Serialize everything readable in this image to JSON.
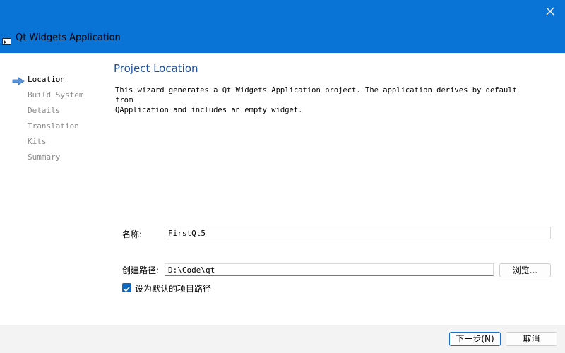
{
  "window": {
    "title": "Qt Widgets Application",
    "titlebar_color": "#0a74d6"
  },
  "sidebar": {
    "steps": [
      {
        "label": "Location",
        "active": true
      },
      {
        "label": "Build System",
        "active": false
      },
      {
        "label": "Details",
        "active": false
      },
      {
        "label": "Translation",
        "active": false
      },
      {
        "label": "Kits",
        "active": false
      },
      {
        "label": "Summary",
        "active": false
      }
    ]
  },
  "page": {
    "title": "Project Location",
    "description_line1": "This wizard generates a Qt Widgets Application project. The application derives by default from",
    "description_line2": "QApplication and includes an empty widget."
  },
  "form": {
    "name_label": "名称:",
    "name_value": "FirstQt5",
    "path_label": "创建路径:",
    "path_value": "D:\\Code\\qt",
    "browse_label": "浏览...",
    "default_checkbox_label": "设为默认的项目路径",
    "default_checked": true
  },
  "footer": {
    "next_label": "下一步(N)",
    "cancel_label": "取消"
  },
  "colors": {
    "accent": "#0c67c0",
    "page_title": "#1d4fa6"
  }
}
